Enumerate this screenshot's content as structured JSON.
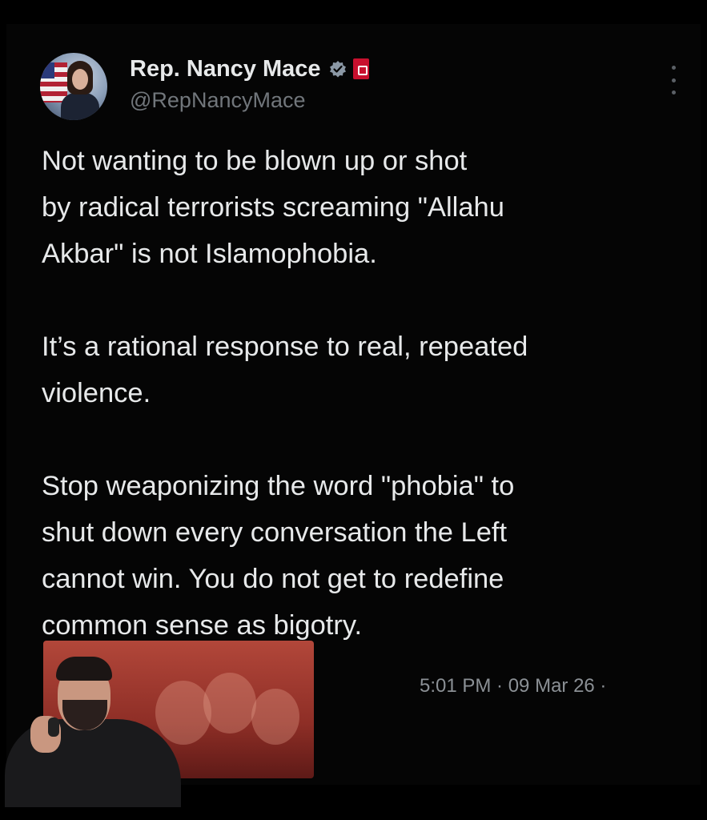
{
  "author": {
    "display_name": "Rep. Nancy Mace",
    "handle": "@RepNancyMace"
  },
  "tweet": {
    "paragraphs": [
      "Not wanting to be blown up or shot\nby radical terrorists screaming \"Allahu\nAkbar\" is not Islamophobia.",
      "It’s a rational response to real, repeated\nviolence.",
      "Stop weaponizing the word \"phobia\"  to\nshut down every conversation the Left\ncannot win. You do not get to redefine\ncommon sense as bigotry."
    ],
    "timestamp": "5:01 PM · 09 Mar 26 ·"
  },
  "icons": {
    "verified": "verified-badge-icon",
    "flag": "flag-badge-icon",
    "more": "more-options-icon"
  },
  "colors": {
    "background": "#000000",
    "text": "#e7e9ea",
    "muted": "#71767b"
  }
}
